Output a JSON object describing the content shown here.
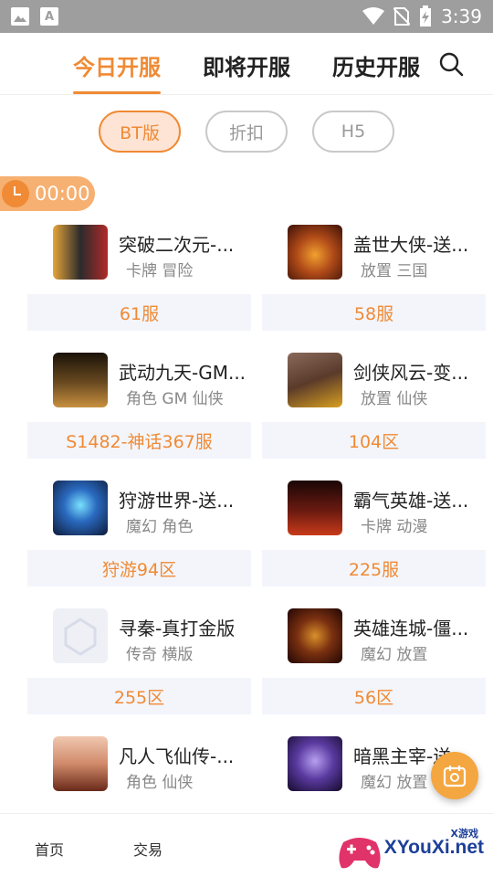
{
  "status_bar": {
    "time": "3:39",
    "icons": [
      "image-icon",
      "font-icon",
      "wifi-icon",
      "no-sim-icon",
      "battery-charging-icon"
    ]
  },
  "tabs": [
    {
      "label": "今日开服",
      "active": true
    },
    {
      "label": "即将开服",
      "active": false
    },
    {
      "label": "历史开服",
      "active": false
    }
  ],
  "filters": [
    {
      "label": "BT版",
      "active": true
    },
    {
      "label": "折扣",
      "active": false
    },
    {
      "label": "H5",
      "active": false
    }
  ],
  "time_badge": "00:00",
  "games": [
    {
      "name": "突破二次元-...",
      "tags": "卡牌 冒险",
      "server": "61服",
      "icon_color": "#2b2b2b"
    },
    {
      "name": "盖世大侠-送...",
      "tags": "放置 三国",
      "server": "58服",
      "icon_color": "#7a2a10"
    },
    {
      "name": "武动九天-GM...",
      "tags": "角色 GM 仙侠",
      "server": "S1482-神话367服",
      "icon_color": "#3a2410"
    },
    {
      "name": "剑侠风云-变...",
      "tags": "放置 仙侠",
      "server": "104区",
      "icon_color": "#5a3a2a"
    },
    {
      "name": "狩游世界-送...",
      "tags": "魔幻 角色",
      "server": "狩游94区",
      "icon_color": "#142c5a"
    },
    {
      "name": "霸气英雄-送...",
      "tags": "卡牌 动漫",
      "server": "225服",
      "icon_color": "#2a0c0c"
    },
    {
      "name": "寻秦-真打金版",
      "tags": "传奇 横版",
      "server": "255区",
      "icon_color": "#eef0f6"
    },
    {
      "name": "英雄连城-僵...",
      "tags": "魔幻 放置",
      "server": "56区",
      "icon_color": "#3a1404"
    },
    {
      "name": "凡人飞仙传-...",
      "tags": "角色 仙侠",
      "server": "",
      "icon_color": "#d08a6a"
    },
    {
      "name": "暗黑主宰-送...",
      "tags": "魔幻 放置",
      "server": "",
      "icon_color": "#2a1a4a"
    }
  ],
  "bottom_nav": [
    {
      "label": "首页"
    },
    {
      "label": "交易"
    }
  ],
  "watermark": {
    "text": "XYouXi.net",
    "small": "X游戏"
  },
  "colors": {
    "accent": "#f08a34",
    "server_bg": "#f3f5fb"
  }
}
